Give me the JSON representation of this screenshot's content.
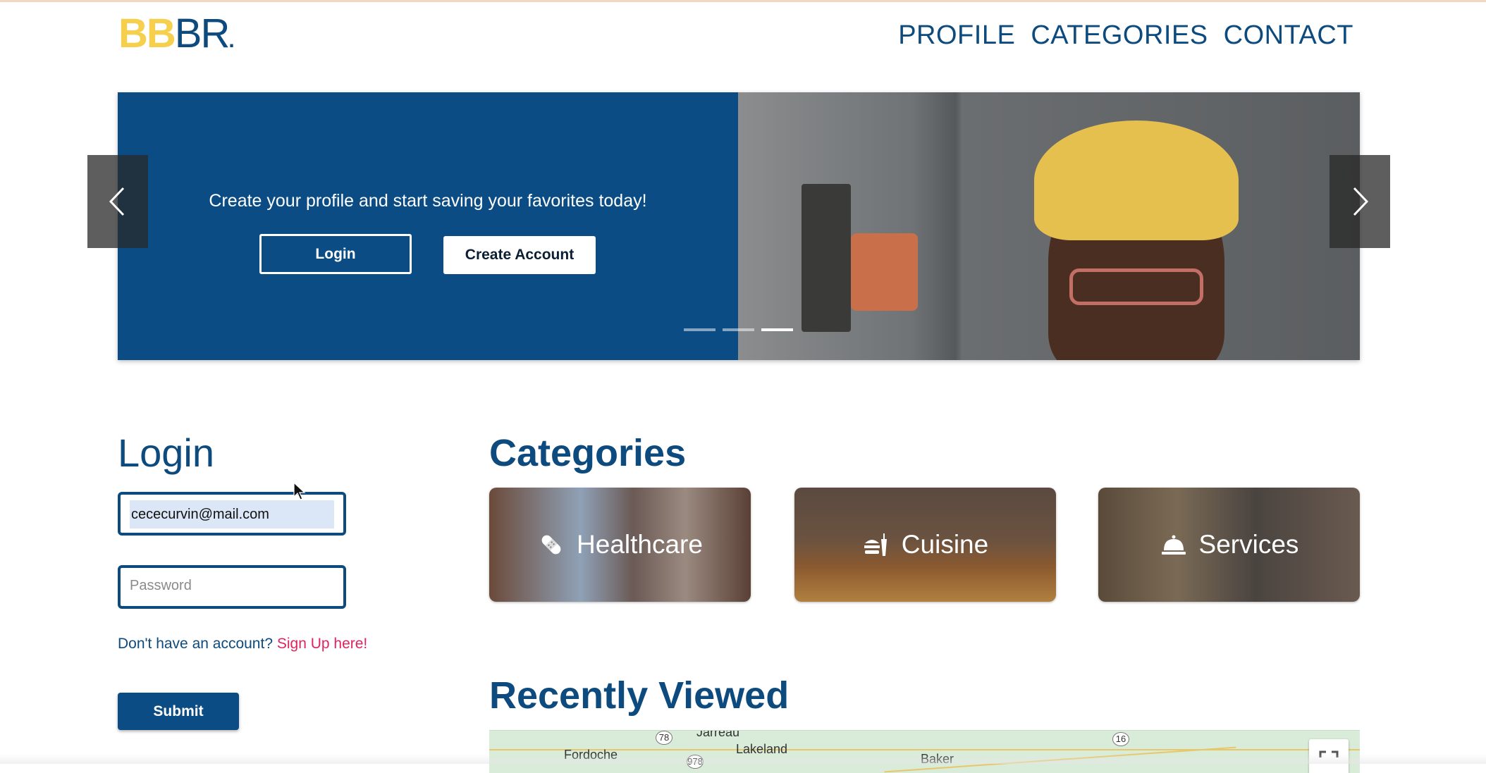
{
  "header": {
    "logo_bb": "BB",
    "logo_br": "BR",
    "logo_dot": ".",
    "nav": [
      "PROFILE",
      "CATEGORIES",
      "CONTACT"
    ]
  },
  "hero": {
    "text": "Create your profile and start saving your favorites today!",
    "login_label": "Login",
    "create_label": "Create Account",
    "slide_count": 3,
    "active_slide": 3
  },
  "login": {
    "title": "Login",
    "email_value": "cececurvin@mail.com",
    "password_placeholder": "Password",
    "signup_prompt": "Don't have an account? ",
    "signup_link": "Sign Up here!",
    "submit_label": "Submit"
  },
  "categories": {
    "title": "Categories",
    "items": [
      {
        "label": "Healthcare",
        "icon": "bandage-icon"
      },
      {
        "label": "Cuisine",
        "icon": "food-icon"
      },
      {
        "label": "Services",
        "icon": "service-bell-icon"
      }
    ]
  },
  "recent": {
    "title": "Recently Viewed",
    "map_labels": [
      "Fordoche",
      "Jarreau",
      "Lakeland",
      "Baker"
    ],
    "map_shields": [
      "78",
      "978",
      "16"
    ]
  },
  "colors": {
    "brand_blue": "#0b4c84",
    "logo_yellow": "#f6d04d",
    "signup_link": "#e0245e"
  }
}
